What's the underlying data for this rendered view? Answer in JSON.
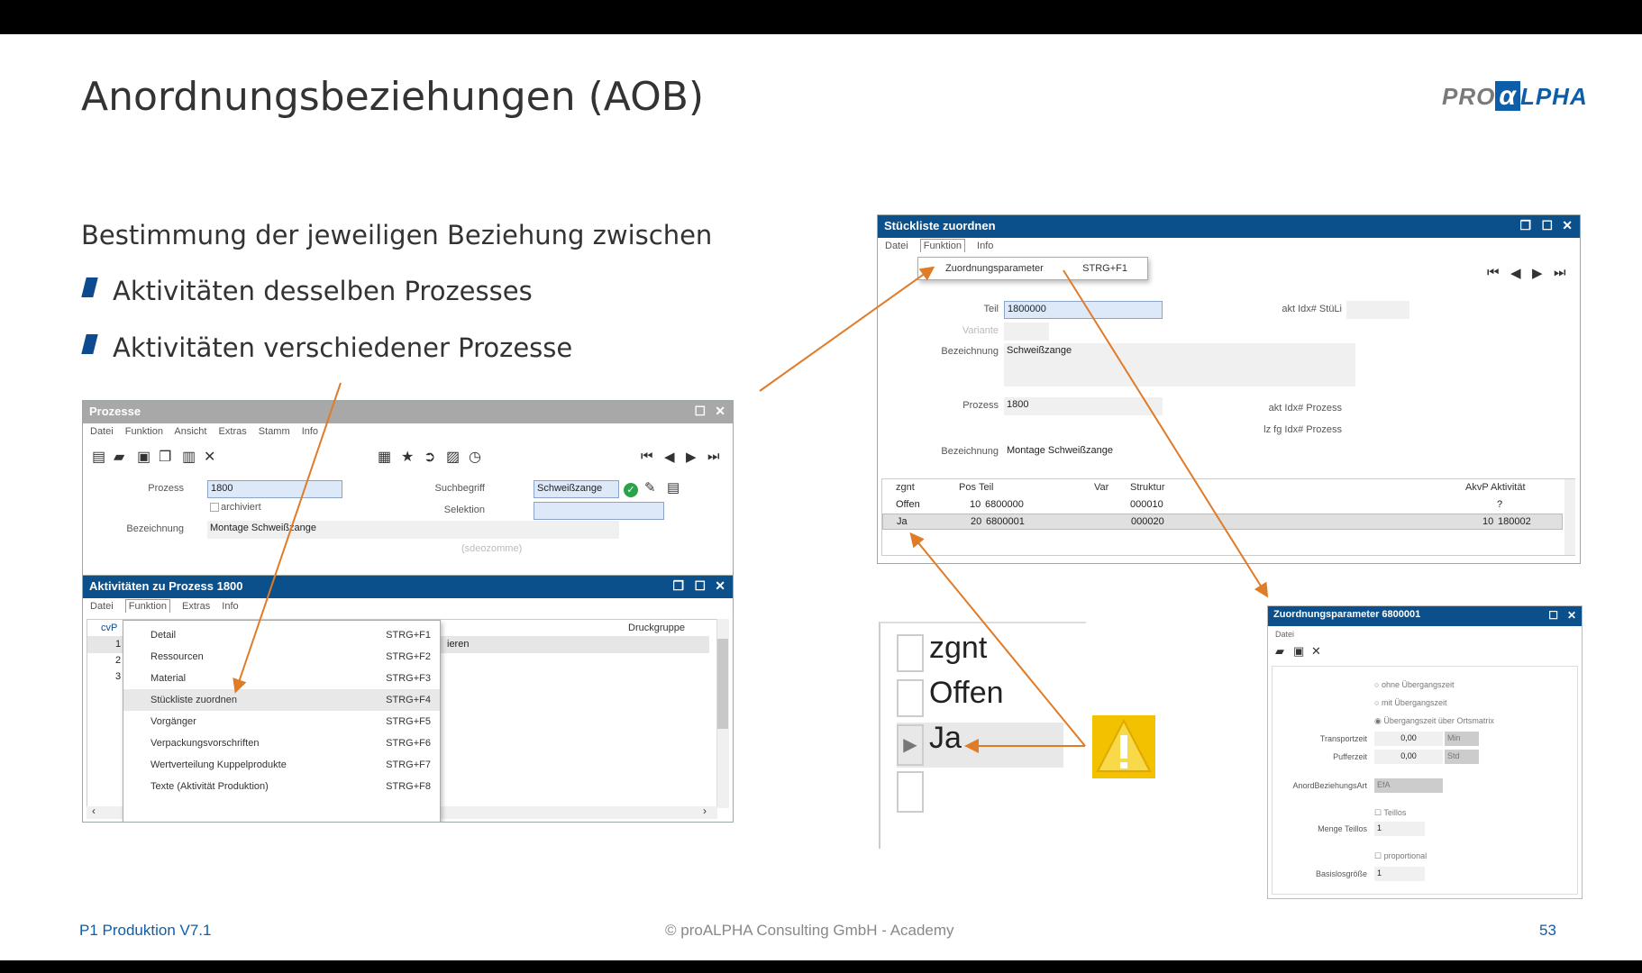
{
  "slide_title": "Anordnungsbeziehungen (AOB)",
  "logo": {
    "pre": "PRO",
    "alpha": "α",
    "post": "LPHA"
  },
  "intro": "Bestimmung der jeweiligen Beziehung zwischen",
  "bullets": [
    "Aktivitäten desselben Prozesses",
    "Aktivitäten verschiedener Prozesse"
  ],
  "footer": {
    "left": "P1 Produktion V7.1",
    "center": "© proALPHA Consulting GmbH - Academy",
    "page": "53"
  },
  "prozesse": {
    "title": "Prozesse",
    "menu": [
      "Datei",
      "Funktion",
      "Ansicht",
      "Extras",
      "Stamm",
      "Info"
    ],
    "prozess_label": "Prozess",
    "prozess_value": "1800",
    "archiviert_label": "archiviert",
    "bezeichnung_label": "Bezeichnung",
    "bezeichnung_value": "Montage Schweißzange",
    "suchbegriff_label": "Suchbegriff",
    "suchbegriff_value": "Schweißzange",
    "selektion_label": "Selektion",
    "faded": "(sdeozomme)"
  },
  "aktivitaeten": {
    "title": "Aktivitäten zu Prozess 1800",
    "menu": [
      "Datei",
      "Funktion",
      "Extras",
      "Info"
    ],
    "col_a": "cvP",
    "col_druck": "Druckgruppe",
    "row_frag": "ieren",
    "rownums": [
      "1",
      "2",
      "3"
    ],
    "popup": [
      {
        "label": "Detail",
        "key": "STRG+F1"
      },
      {
        "label": "Ressourcen",
        "key": "STRG+F2"
      },
      {
        "label": "Material",
        "key": "STRG+F3"
      },
      {
        "label": "Stückliste zuordnen",
        "key": "STRG+F4"
      },
      {
        "label": "Vorgänger",
        "key": "STRG+F5"
      },
      {
        "label": "Verpackungsvorschriften",
        "key": "STRG+F6"
      },
      {
        "label": "Wertverteilung Kuppelprodukte",
        "key": "STRG+F7"
      },
      {
        "label": "Texte (Aktivität Produktion)",
        "key": "STRG+F8"
      }
    ]
  },
  "stueckliste": {
    "title": "Stückliste zuordnen",
    "menu": [
      "Datei",
      "Funktion",
      "Info"
    ],
    "dropdown_label": "Zuordnungsparameter",
    "dropdown_key": "STRG+F1",
    "teil_label": "Teil",
    "teil_value": "1800000",
    "variante_label": "Variante",
    "bez_label": "Bezeichnung",
    "bez_value": "Schweißzange",
    "prozess_label": "Prozess",
    "prozess_value": "1800",
    "bez2_label": "Bezeichnung",
    "bez2_value": "Montage Schweißzange",
    "akt_stuli": "akt Idx# StüLi",
    "akt_prozess": "akt Idx# Prozess",
    "lz_prozess": "lz fg Idx# Prozess",
    "headers": [
      "zgnt",
      "Pos",
      "Teil",
      "Var",
      "Struktur",
      "AkvP",
      "Aktivität"
    ],
    "rows": [
      {
        "zgnt": "Offen",
        "pos": "10",
        "teil": "6800000",
        "struktur": "000010",
        "akvp": "",
        "akt": "?"
      },
      {
        "zgnt": "Ja",
        "pos": "20",
        "teil": "6800001",
        "struktur": "000020",
        "akvp": "10",
        "akt": "180002"
      }
    ]
  },
  "zoom": {
    "header": "zgnt",
    "rows": [
      "Offen",
      "Ja"
    ]
  },
  "zuordnung": {
    "title": "Zuordnungsparameter 6800001",
    "menu": "Datei",
    "opt1": "ohne Übergangszeit",
    "opt2": "mit Übergangszeit",
    "opt3": "Übergangszeit über Ortsmatrix",
    "transportzeit_label": "Transportzeit",
    "transportzeit_value": "0,00",
    "transportzeit_unit": "Min",
    "pufferzeit_label": "Pufferzeit",
    "pufferzeit_value": "0,00",
    "pufferzeit_unit": "Std",
    "anord_label": "AnordBeziehungsArt",
    "anord_value": "EfA",
    "teillos_label": "Teillos",
    "menge_label": "Menge Teillos",
    "menge_value": "1",
    "proportional_label": "proportional",
    "basislos_label": "Basislosgröße",
    "basislos_value": "1"
  },
  "colors": {
    "accent_blue": "#0b4f8b",
    "arrow_orange": "#e07b28",
    "warning_yellow": "#f2c100"
  }
}
